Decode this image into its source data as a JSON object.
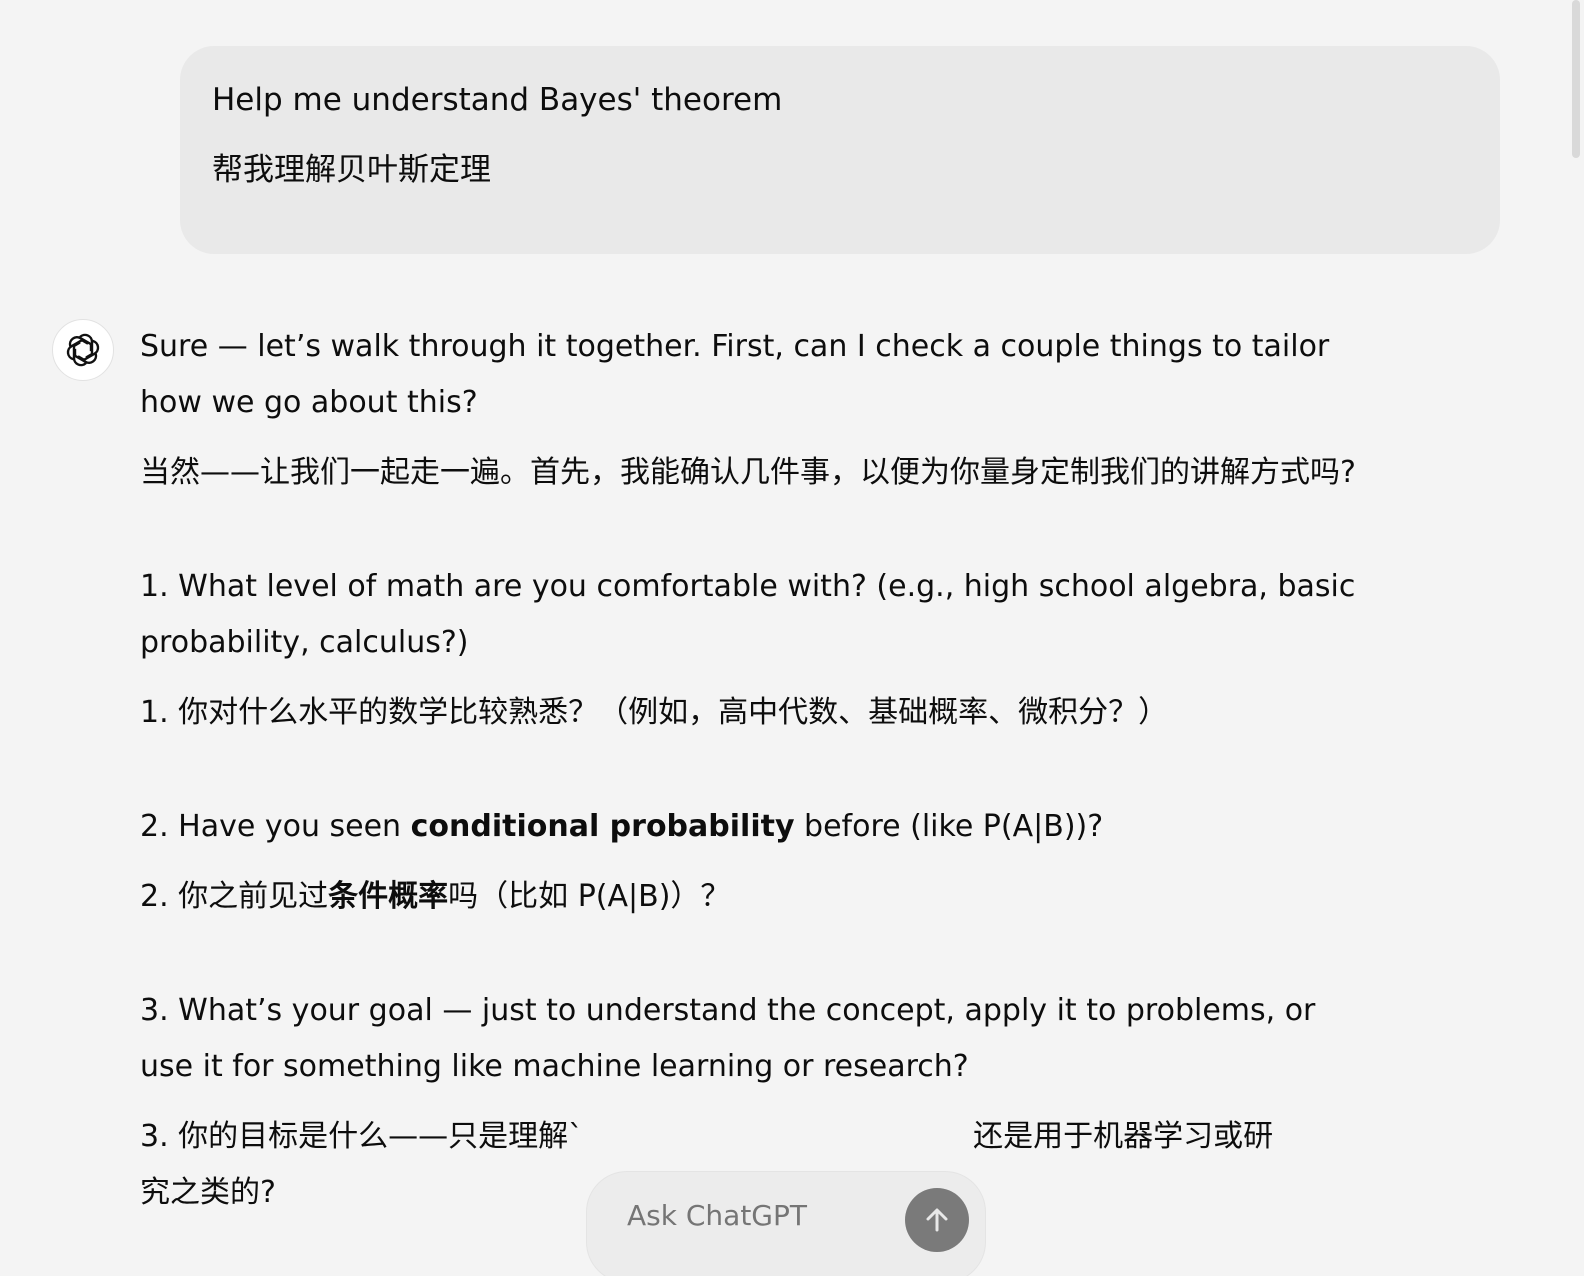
{
  "user_message": {
    "line_en": "Help me understand Bayes' theorem",
    "line_zh": "帮我理解贝叶斯定理"
  },
  "assistant": {
    "avatar_icon": "openai-logo-icon",
    "intro_en": "Sure — let’s walk through it together. First, can I check a couple things to tailor how we go about this?",
    "intro_zh": "当然——让我们一起走一遍。首先，我能确认几件事，以便为你量身定制我们的讲解方式吗?",
    "q1_en": "1. What level of math are you comfortable with? (e.g., high school algebra, basic probability, calculus?)",
    "q1_zh": "1. 你对什么水平的数学比较熟悉？（例如，高中代数、基础概率、微积分？）",
    "q2_en_pre": "2. Have you seen ",
    "q2_en_bold": "conditional probability",
    "q2_en_post": " before (like P(A|B))?",
    "q2_zh_pre": "2. 你之前见过",
    "q2_zh_bold": "条件概率",
    "q2_zh_post": "吗（比如 P(A|B)）？",
    "q3_en": "3. What’s your goal — just to understand the concept, apply it to problems, or use it for something like machine learning or research?",
    "q3_zh_visible_start": "3. 你的目标是什么——只是理解`",
    "q3_zh_visible_end": "还是用于机器学习或研",
    "q3_zh_line2": "究之类的?"
  },
  "composer": {
    "placeholder": "Ask ChatGPT",
    "send_icon": "arrow-up-icon"
  }
}
